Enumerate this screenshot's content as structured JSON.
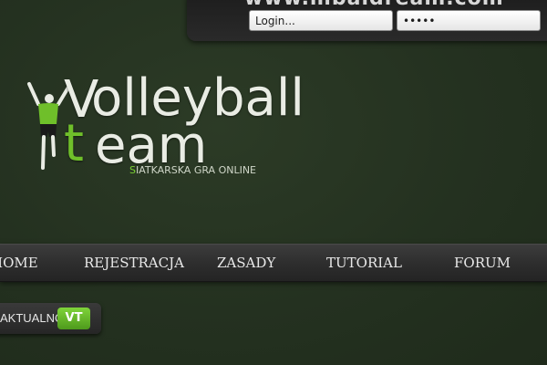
{
  "header": {
    "site_url": "www.mbaidream.com",
    "login": {
      "username_value": "Login...",
      "password_value": "*****"
    }
  },
  "logo": {
    "line1_v": "V",
    "line1_rest": "olleyball",
    "line2_t": "t",
    "line2_rest": "eam",
    "tagline_first": "S",
    "tagline_rest": "IATKARSKA GRA ONLINE"
  },
  "nav": {
    "items": [
      {
        "label": "HOME"
      },
      {
        "label": "REJESTRACJA"
      },
      {
        "label": "ZASADY"
      },
      {
        "label": "TUTORIAL"
      },
      {
        "label": "FORUM"
      }
    ]
  },
  "news": {
    "label": "AKTUALNOŚCI",
    "badge": "VT"
  },
  "colors": {
    "background": "#243120",
    "accent_green": "#6fbf2a",
    "nav_bar": "#2d2d2d"
  }
}
